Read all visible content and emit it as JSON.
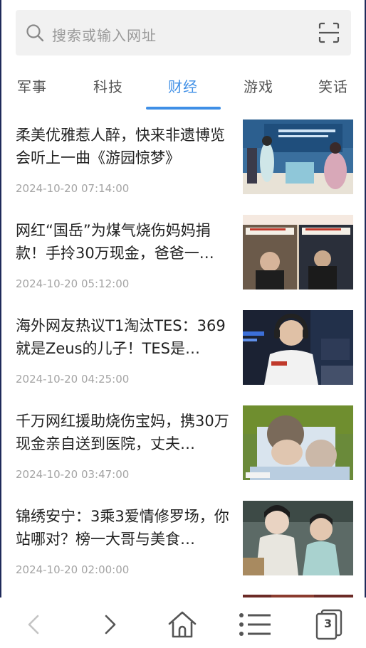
{
  "search": {
    "placeholder": "搜索或输入网址"
  },
  "tabs": [
    {
      "label": "军事"
    },
    {
      "label": "科技"
    },
    {
      "label": "财经"
    },
    {
      "label": "游戏"
    },
    {
      "label": "笑话"
    }
  ],
  "active_tab_color": "#3f8fe6",
  "news": [
    {
      "title": "柔美优雅惹人醉，快来非遗博览会听上一曲《游园惊梦》",
      "time": "2024-10-20 07:14:00"
    },
    {
      "title": "网红“国岳”为煤气烧伤妈妈捐款！手拎30万现金，爸爸一…",
      "time": "2024-10-20 05:12:00"
    },
    {
      "title": "海外网友热议T1淘汰TES：369就是Zeus的儿子！TES是…",
      "time": "2024-10-20 04:25:00"
    },
    {
      "title": "千万网红援助烧伤宝妈，携30万现金亲自送到医院，丈夫…",
      "time": "2024-10-20 03:47:00"
    },
    {
      "title": "锦绣安宁：3乘3爱情修罗场，你站哪对？榜一大哥与美食…",
      "time": "2024-10-20 02:00:00"
    }
  ],
  "bottom_nav": {
    "back_icon": "chevron-left-icon",
    "forward_icon": "chevron-right-icon",
    "home_icon": "home-icon",
    "menu_icon": "menu-icon",
    "tabs_count": "3"
  }
}
